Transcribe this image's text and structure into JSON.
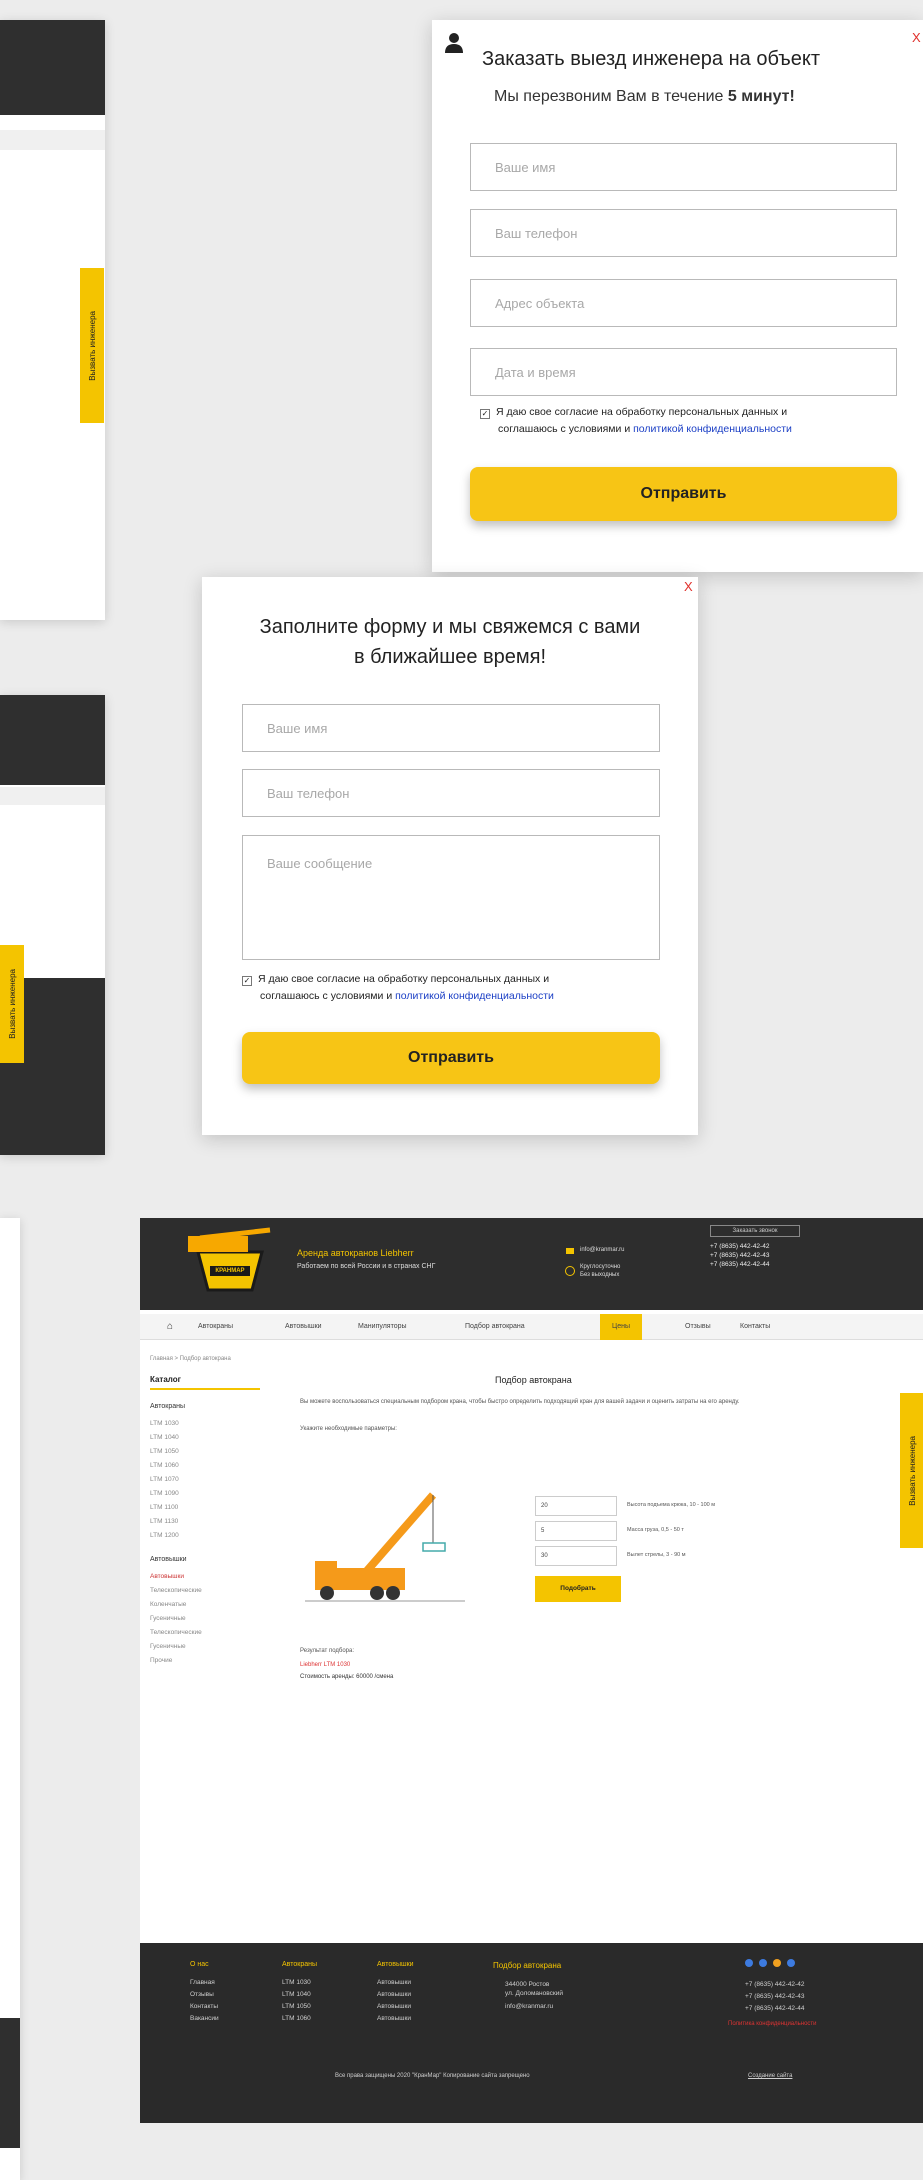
{
  "engineer_popup": {
    "close": "X",
    "title": "Заказать выезд инженера на объект",
    "subtitle_prefix": "Мы перезвоним Вам в течение ",
    "subtitle_bold": "5 минут!",
    "fields": [
      "Ваше имя",
      "Ваш телефон",
      "Адрес объекта",
      "Дата и время"
    ],
    "consent_line1": "Я даю свое согласие на обработку персональных данных и",
    "consent_line2_prefix": "соглашаюсь с условиями и ",
    "consent_link": "политикой конфиденциальности",
    "submit": "Отправить"
  },
  "contact_popup": {
    "close": "X",
    "title_line1": "Заполните форму и мы свяжемся с вами",
    "title_line2": "в ближайшее время!",
    "fields": [
      "Ваше имя",
      "Ваш телефон",
      "Ваше сообщение"
    ],
    "consent_line1": "Я даю свое согласие на обработку персональных данных и",
    "consent_line2_prefix": "соглашаюсь с условиями и ",
    "consent_link": "политикой конфиденциальности",
    "submit": "Отправить"
  },
  "side_tab": "Вызвать инженера",
  "site": {
    "tagline_title": "Аренда автокранов Liebherr",
    "tagline_sub": "Работаем по всей России и в странах СНГ",
    "header_info": [
      "info@kranmar.ru",
      "Круглосуточно",
      "Без выходных"
    ],
    "phones": [
      "+7 (8635) 442-42-42",
      "+7 (8635) 442-42-43",
      "+7 (8635) 442-42-44"
    ],
    "callback": "Заказать звонок",
    "nav": [
      "Автокраны",
      "Автовышки",
      "Манипуляторы",
      "Подбор автокрана",
      "Цены",
      "Отзывы",
      "Контакты"
    ],
    "breadcrumb": "Главная > Подбор автокрана",
    "page_title": "Подбор автокрана",
    "intro": "Вы можете воспользоваться специальным подбором крана, чтобы быстро определить подходящий кран для вашей задачи и оценить затраты на его аренду.",
    "intro2": "Укажите необходимые параметры:",
    "catalog_title": "Каталог",
    "cat_group1": "Автокраны",
    "cat_items1": [
      "LTM 1030",
      "LTM 1040",
      "LTM 1050",
      "LTM 1060",
      "LTM 1070",
      "LTM 1090",
      "LTM 1100",
      "LTM 1130",
      "LTM 1200"
    ],
    "cat_group2": "Автовышки",
    "cat_items2": [
      "Автовышки",
      "Телескопические",
      "Коленчатые",
      "Гусеничные",
      "Телескопические",
      "Гусеничные",
      "Прочие"
    ],
    "calc_inputs": [
      "20",
      "5",
      "30"
    ],
    "calc_labels": [
      "Высота подъема крюка, 10 - 100 м",
      "Масса груза, 0,5 - 50 т",
      "Вылет стрелы, 3 - 90 м"
    ],
    "calc_button": "Подобрать",
    "result_title": "Результат подбора:",
    "result_item": "Liebherr LTM 1030",
    "result_price": "Стоимость аренды: 60000 /смена",
    "footer_cols": [
      {
        "head": "О нас",
        "items": [
          "Главная",
          "Отзывы",
          "Контакты",
          "Вакансии"
        ]
      },
      {
        "head": "Автокраны",
        "items": [
          "LTM 1030",
          "LTM 1040",
          "LTM 1050",
          "LTM 1060"
        ]
      },
      {
        "head": "Автовышки",
        "items": [
          "Автовышки",
          "Автовышки",
          "Автовышки",
          "Автовышки"
        ]
      }
    ],
    "footer_calc": "Подбор автокрана",
    "footer_contacts": [
      "344000 Ростов",
      "ул. Доломановский",
      "info@kranmar.ru"
    ],
    "footer_phones": [
      "+7 (8635) 442-42-42",
      "+7 (8635) 442-42-43",
      "+7 (8635) 442-42-44"
    ],
    "footer_policy": "Политика конфиденциальности",
    "copyright": "Все права защищены 2020 \"КранМар\" Копирование сайта запрещено",
    "dev": "Создание сайта",
    "logo_text": "КРАНМАР"
  },
  "colors": {
    "accent": "#f7c515",
    "dark": "#2d2d2d",
    "close": "#e0302b",
    "link": "#1a3ec5"
  }
}
